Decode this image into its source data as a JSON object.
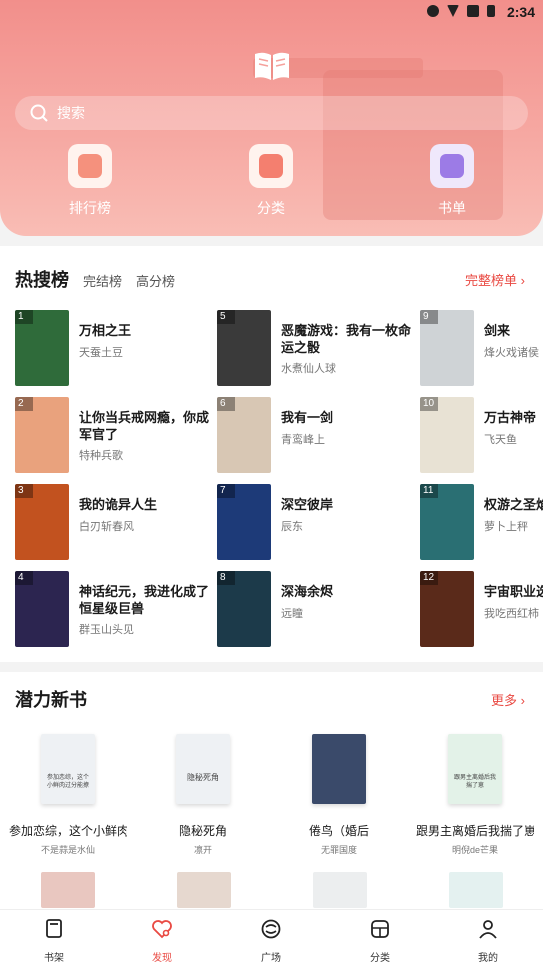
{
  "status_bar": {
    "time": "2:34"
  },
  "search": {
    "placeholder": "搜索"
  },
  "quick_links": [
    {
      "label": "排行榜",
      "icon": "ranking-chart-icon"
    },
    {
      "label": "分类",
      "icon": "category-flag-icon"
    },
    {
      "label": "书单",
      "icon": "booklist-icon"
    }
  ],
  "hot": {
    "title": "热搜榜",
    "tabs": [
      "完结榜",
      "高分榜"
    ],
    "more": "完整榜单 ›",
    "items": [
      {
        "rank": "1",
        "title": "万相之王",
        "author": "天蚕土豆",
        "color": "#2f6b3a"
      },
      {
        "rank": "2",
        "title": "让你当兵戒网瘾，你成军官了",
        "author": "特种兵歌",
        "color": "#e9a27d"
      },
      {
        "rank": "3",
        "title": "我的诡异人生",
        "author": "白刃斩春风",
        "color": "#c2521f"
      },
      {
        "rank": "4",
        "title": "神话纪元，我进化成了恒星级巨兽",
        "author": "群玉山头见",
        "color": "#2c2550"
      },
      {
        "rank": "5",
        "title": "恶魔游戏：我有一枚命运之骰",
        "author": "水煮仙人球",
        "color": "#3a3a3a"
      },
      {
        "rank": "6",
        "title": "我有一剑",
        "author": "青鸾峰上",
        "color": "#d8c7b4"
      },
      {
        "rank": "7",
        "title": "深空彼岸",
        "author": "辰东",
        "color": "#1d3a78"
      },
      {
        "rank": "8",
        "title": "深海余烬",
        "author": "远瞳",
        "color": "#1c3a4a"
      },
      {
        "rank": "9",
        "title": "剑来",
        "author": "烽火戏诸侯",
        "color": "#cfd3d6"
      },
      {
        "rank": "10",
        "title": "万古神帝",
        "author": "飞天鱼",
        "color": "#e8e2d4"
      },
      {
        "rank": "11",
        "title": "权游之圣焰",
        "author": "萝卜上秤",
        "color": "#2a6f73"
      },
      {
        "rank": "12",
        "title": "宇宙职业选",
        "author": "我吃西红柿",
        "color": "#5a2a1a"
      }
    ]
  },
  "new_books": {
    "title": "潜力新书",
    "more": "更多 ›",
    "items": [
      {
        "title": "参加恋综，这个小鲜肉…",
        "author": "不是蒜是水仙",
        "color": "#eef1f4",
        "cover_text": "参加恋综，这个小鲜肉过分能撩"
      },
      {
        "title": "隐秘死角",
        "author": "凛开",
        "color": "#eef1f4",
        "cover_text": "隐秘死角"
      },
      {
        "title": "倦鸟（婚后",
        "author": "无罪国度",
        "color": "#3a4a6a",
        "cover_text": ""
      },
      {
        "title": "跟男主离婚后我揣了崽",
        "author": "明倪de芒果",
        "color": "#e3f2e8",
        "cover_text": "跟男主离婚后我揣了崽"
      }
    ]
  },
  "tabbar": [
    {
      "label": "书架",
      "icon": "bookshelf-icon"
    },
    {
      "label": "发现",
      "icon": "discover-heart-icon"
    },
    {
      "label": "广场",
      "icon": "square-icon"
    },
    {
      "label": "分类",
      "icon": "category-icon"
    },
    {
      "label": "我的",
      "icon": "profile-icon"
    }
  ],
  "colors": {
    "accent": "#e94a43",
    "header": "#f6a7a1"
  }
}
